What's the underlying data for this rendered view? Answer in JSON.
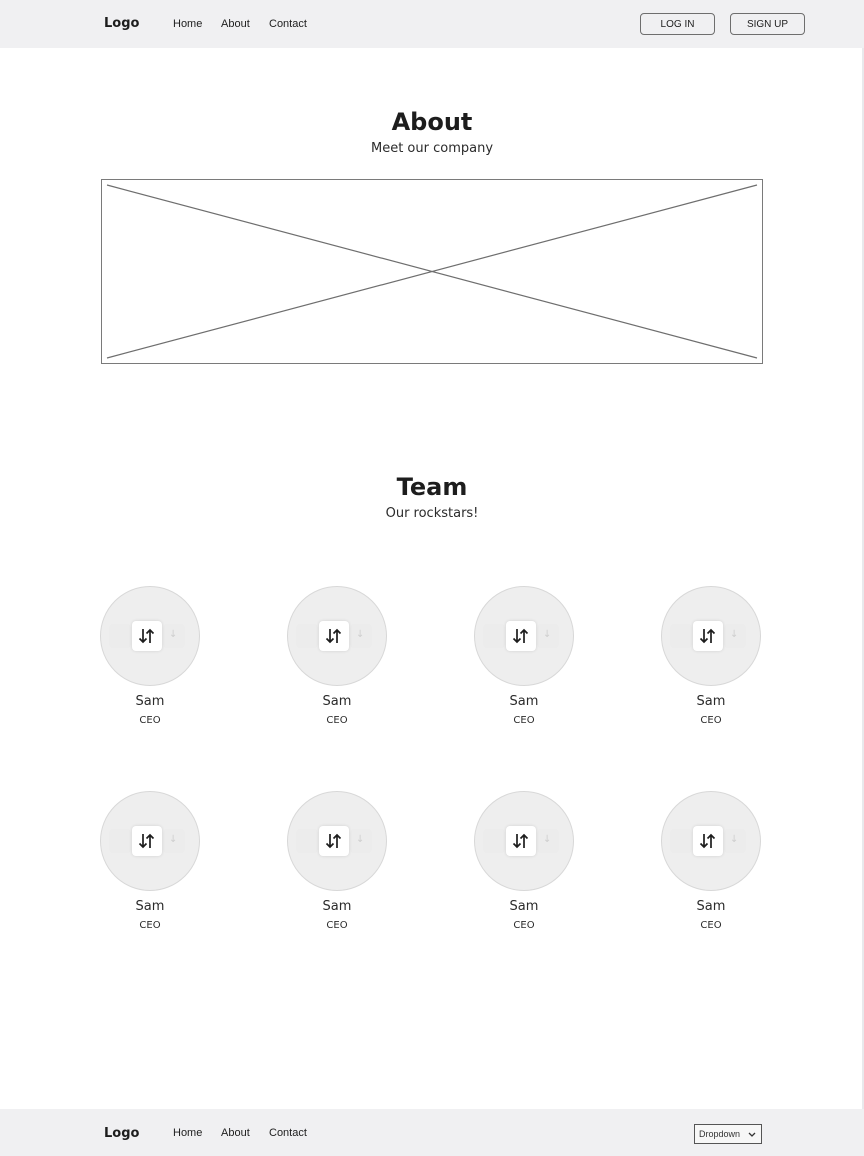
{
  "header": {
    "logo": "Logo",
    "nav": [
      "Home",
      "About",
      "Contact"
    ],
    "login_label": "LOG IN",
    "signup_label": "SIGN UP"
  },
  "about": {
    "title": "About",
    "subtitle": "Meet our company"
  },
  "team": {
    "title": "Team",
    "subtitle": "Our rockstars!",
    "members": [
      {
        "name": "Sam",
        "role": "CEO"
      },
      {
        "name": "Sam",
        "role": "CEO"
      },
      {
        "name": "Sam",
        "role": "CEO"
      },
      {
        "name": "Sam",
        "role": "CEO"
      },
      {
        "name": "Sam",
        "role": "CEO"
      },
      {
        "name": "Sam",
        "role": "CEO"
      },
      {
        "name": "Sam",
        "role": "CEO"
      },
      {
        "name": "Sam",
        "role": "CEO"
      }
    ]
  },
  "footer": {
    "logo": "Logo",
    "nav": [
      "Home",
      "About",
      "Contact"
    ],
    "dropdown_value": "Dropdown"
  },
  "icons": {
    "image_placeholder": "image-placeholder-icon",
    "avatar": "swap-arrows-icon",
    "dropdown": "chevron-down-icon"
  },
  "colors": {
    "bar_background": "#f0f0f2",
    "border": "#6e6e6e",
    "avatar_fill": "#eeeeee"
  }
}
